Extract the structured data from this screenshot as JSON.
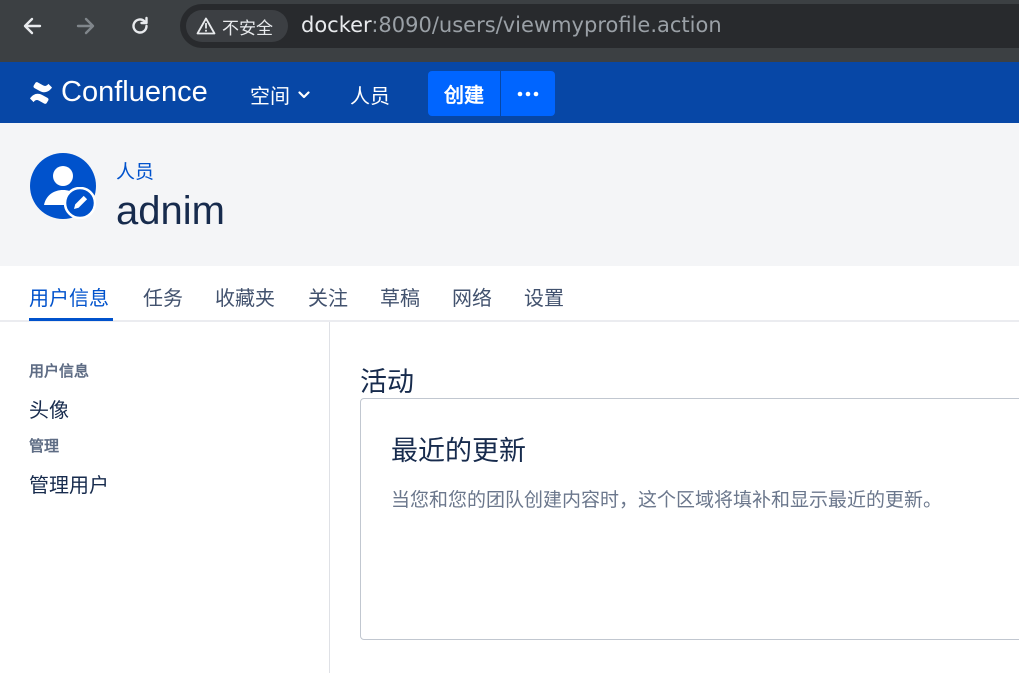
{
  "browser": {
    "security_label": "不安全",
    "url_host": "docker",
    "url_rest": ":8090/users/viewmyprofile.action"
  },
  "appbar": {
    "logo_text": "Confluence",
    "spaces_label": "空间",
    "people_label": "人员",
    "create_label": "创建"
  },
  "profile": {
    "breadcrumb": "人员",
    "username": "adnim"
  },
  "tabs": [
    {
      "label": "用户信息",
      "active": true
    },
    {
      "label": "任务"
    },
    {
      "label": "收藏夹"
    },
    {
      "label": "关注"
    },
    {
      "label": "草稿"
    },
    {
      "label": "网络"
    },
    {
      "label": "设置"
    }
  ],
  "sidebar": {
    "section1_heading": "用户信息",
    "section1_link": "头像",
    "section2_heading": "管理",
    "section2_link": "管理用户"
  },
  "main": {
    "title": "活动",
    "card_title": "最近的更新",
    "card_body": "当您和您的团队创建内容时，这个区域将填补和显示最近的更新。"
  },
  "colors": {
    "brand": "#0747a6",
    "create": "#0065ff",
    "link": "#0052cc"
  }
}
